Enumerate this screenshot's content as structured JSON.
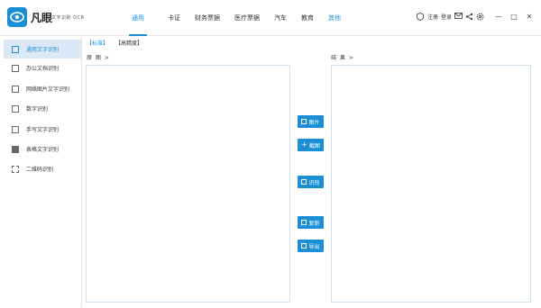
{
  "app": {
    "name": "凡眼",
    "subtitle": "文字识别 OCR"
  },
  "nav": {
    "items": [
      {
        "label": "通用",
        "state": "active"
      },
      {
        "label": "卡证"
      },
      {
        "label": "财务票据"
      },
      {
        "label": "医疗票据"
      },
      {
        "label": "汽车"
      },
      {
        "label": "教育"
      },
      {
        "label": "其他",
        "state": "other"
      }
    ]
  },
  "header_right": {
    "register": "注册",
    "login": "登录",
    "icons": [
      "shield-icon",
      "mail-icon",
      "share-icon",
      "settings-icon"
    ],
    "window": {
      "minimize": "—",
      "maximize": "□",
      "close": "✕"
    }
  },
  "sidebar": {
    "items": [
      {
        "label": "通用文字识别",
        "icon": "text-recognition-icon",
        "active": true
      },
      {
        "label": "办公文档识别",
        "icon": "document-icon"
      },
      {
        "label": "网络图片文字识别",
        "icon": "web-image-icon"
      },
      {
        "label": "数字识别",
        "icon": "number-icon"
      },
      {
        "label": "手写文字识别",
        "icon": "handwriting-icon"
      },
      {
        "label": "表格文字识别",
        "icon": "table-icon"
      },
      {
        "label": "二维码识别",
        "icon": "qrcode-icon"
      }
    ]
  },
  "mode_tabs": [
    {
      "label": "【标准】",
      "active": true
    },
    {
      "label": "【高精度】"
    }
  ],
  "labels": {
    "source": "原 图 >",
    "result": "结 果 >"
  },
  "actions": {
    "image": "图片",
    "screenshot": "截图",
    "recognize": "识别",
    "copy": "复制",
    "export": "导出"
  },
  "colors": {
    "accent": "#1a8fd6",
    "active_bg": "#dbe9f7",
    "panel_border": "#cfe0ea"
  }
}
